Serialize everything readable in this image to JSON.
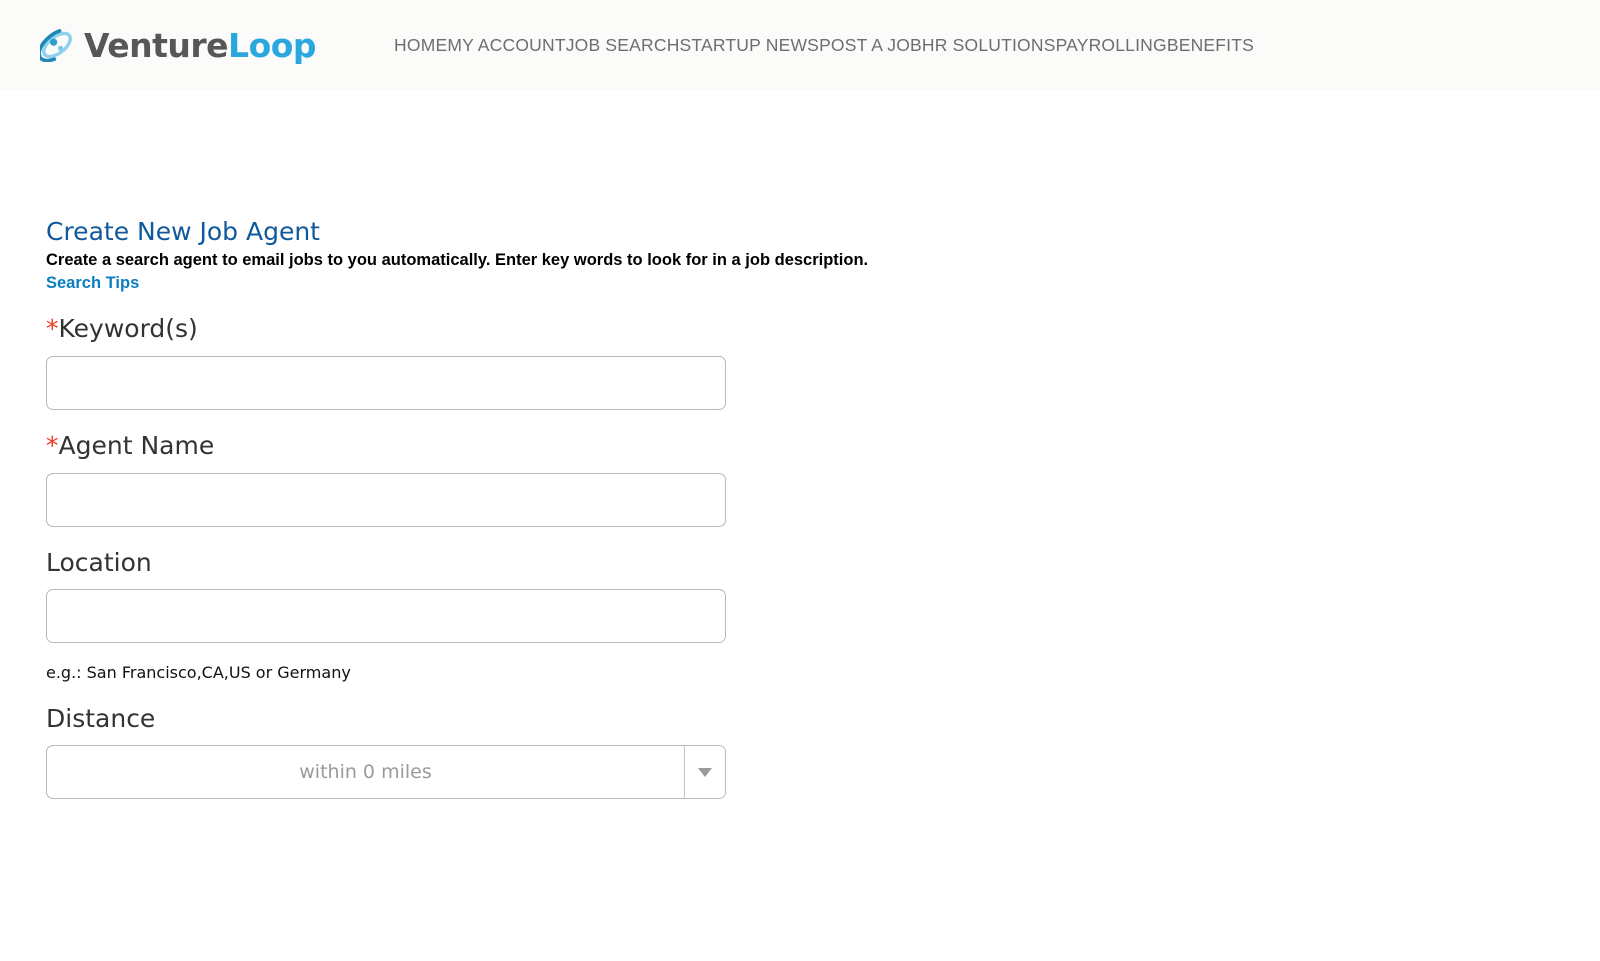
{
  "header": {
    "logo": {
      "icon": "orbit-atom-icon",
      "text_part1": "Venture",
      "text_part2": "Loop",
      "color_part1": "#575757",
      "color_part2": "#29a8dd"
    },
    "nav": [
      {
        "label": "HOME"
      },
      {
        "label": "MY ACCOUNT"
      },
      {
        "label": "JOB SEARCH"
      },
      {
        "label": "STARTUP NEWS"
      },
      {
        "label": "POST A JOB"
      },
      {
        "label": "HR SOLUTIONS"
      },
      {
        "label": "PAYROLLING"
      },
      {
        "label": "BENEFITS"
      }
    ]
  },
  "main": {
    "title": "Create New Job Agent",
    "description": "Create a search agent to email jobs to you automatically. Enter key words to look for in a job description.",
    "search_tips_link": "Search Tips",
    "required_marker": "*",
    "fields": {
      "keywords": {
        "label": "Keyword(s)",
        "required": true,
        "value": "",
        "placeholder": ""
      },
      "agent_name": {
        "label": "Agent Name",
        "required": true,
        "value": "",
        "placeholder": ""
      },
      "location": {
        "label": "Location",
        "required": false,
        "value": "",
        "placeholder": "",
        "hint": "e.g.: San Francisco,CA,US or Germany"
      },
      "distance": {
        "label": "Distance",
        "required": false,
        "selected": "within 0 miles",
        "caret_icon": "chevron-down-icon"
      }
    }
  },
  "colors": {
    "title_blue": "#10599c",
    "link_blue": "#0b7ec2",
    "required_red": "#f03b20",
    "header_bg": "#fbfbf9",
    "nav_text": "#6e6e6e",
    "border_gray": "#b9b9b9"
  }
}
